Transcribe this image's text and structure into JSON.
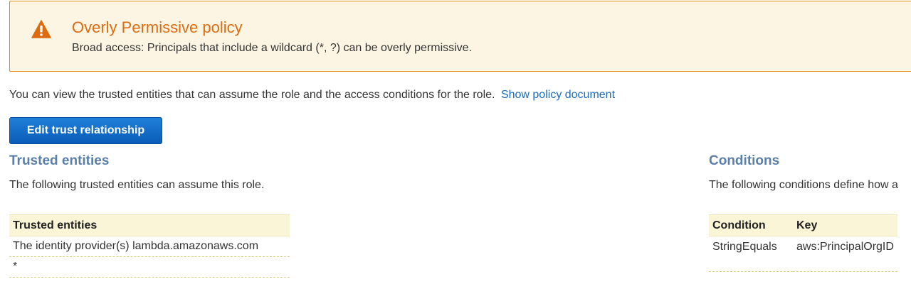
{
  "alert": {
    "title": "Overly Permissive policy",
    "body": "Broad access: Principals that include a wildcard (*, ?) can be overly permissive.",
    "icon": "warning-icon",
    "colors": {
      "title": "#dd6b10",
      "background": "#fcf5e3",
      "border": "#e58b12"
    }
  },
  "description": {
    "text": "You can view the trusted entities that can assume the role and the access conditions for the role.",
    "link": "Show policy document"
  },
  "toolbar": {
    "edit_label": "Edit trust relationship"
  },
  "trusted": {
    "title": "Trusted entities",
    "subtitle": "The following trusted entities can assume this role.",
    "columns": [
      "Trusted entities"
    ],
    "rows": [
      "The identity provider(s) lambda.amazonaws.com",
      "*"
    ]
  },
  "conditions": {
    "title": "Conditions",
    "subtitle": "The following conditions define how a",
    "columns": [
      "Condition",
      "Key"
    ],
    "rows": [
      {
        "condition": "StringEquals",
        "key": "aws:PrincipalOrgID"
      }
    ]
  }
}
